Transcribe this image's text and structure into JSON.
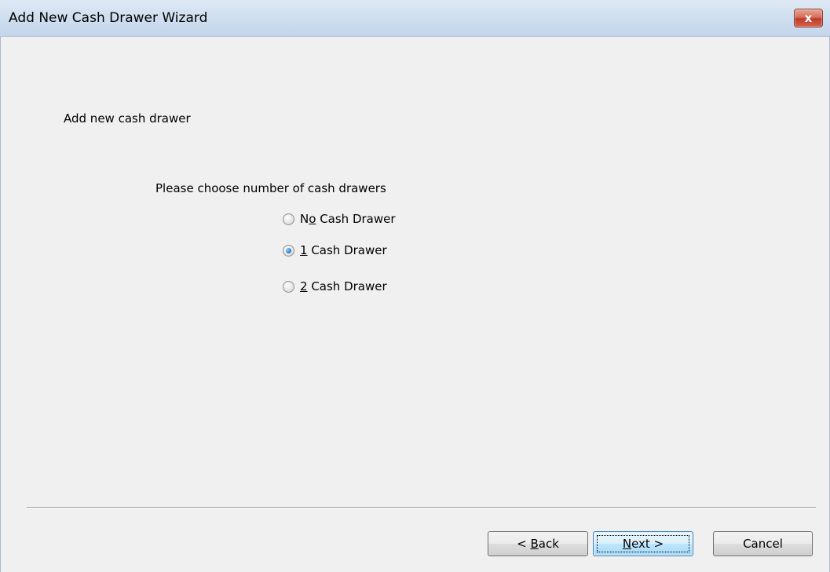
{
  "window": {
    "title": "Add New Cash Drawer Wizard",
    "close_label": "x"
  },
  "main": {
    "heading": "Add new cash drawer",
    "prompt": "Please choose number of cash drawers",
    "options": [
      {
        "pre": "N",
        "accel": "o",
        "post": " Cash Drawer",
        "checked": false
      },
      {
        "pre": "",
        "accel": "1",
        "post": " Cash Drawer",
        "checked": true
      },
      {
        "pre": "",
        "accel": "2",
        "post": " Cash Drawer",
        "checked": false
      }
    ]
  },
  "footer": {
    "back_pre": "< ",
    "back_accel": "B",
    "back_post": "ack",
    "next_accel": "N",
    "next_post": "ext >",
    "cancel_label": "Cancel"
  }
}
